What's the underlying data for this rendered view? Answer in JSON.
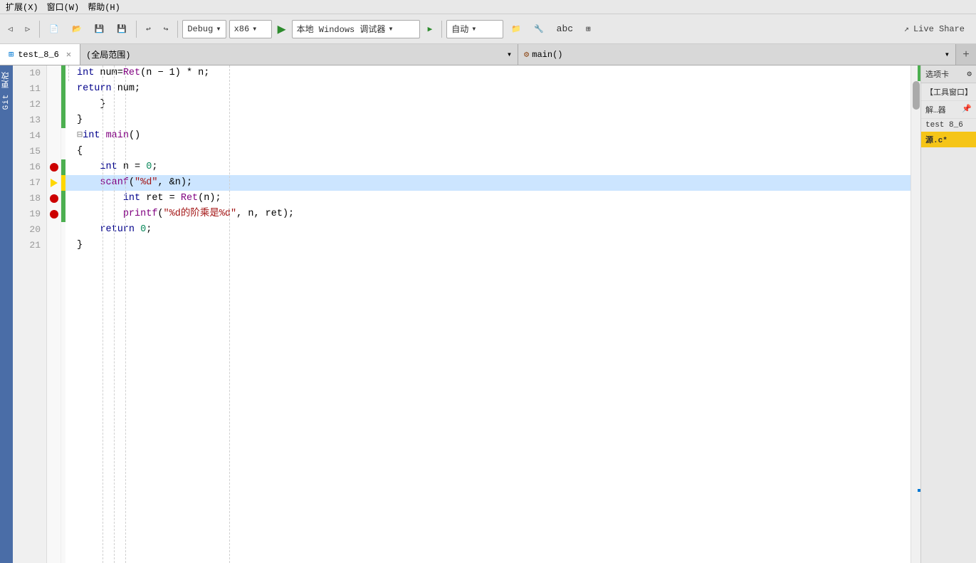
{
  "menubar": {
    "items": [
      "扩展(X)",
      "窗口(W)",
      "帮助(H)"
    ]
  },
  "toolbar": {
    "back_btn": "◀",
    "forward_btn": "▶",
    "debug_label": "Debug",
    "platform_label": "x86",
    "run_icon": "▶",
    "local_debug_label": "本地 Windows 调试器",
    "run2_icon": "▶",
    "auto_label": "自动",
    "live_share_label": "Live Share"
  },
  "tabs": {
    "file_tab": "test_8_6",
    "scope_placeholder": "(全局范围)",
    "func_placeholder": "main()",
    "add_btn": "+"
  },
  "sidebar": {
    "git_label": "Git 更改"
  },
  "code": {
    "lines": [
      {
        "num": "10",
        "content": "    int num=Ret(n − 1) * n;",
        "type": "normal",
        "has_breakpoint": false,
        "has_change": true
      },
      {
        "num": "11",
        "content": "    return num;",
        "type": "normal",
        "has_breakpoint": false,
        "has_change": true
      },
      {
        "num": "12",
        "content": "    }",
        "type": "normal",
        "has_breakpoint": false,
        "has_change": true
      },
      {
        "num": "13",
        "content": "}",
        "type": "normal",
        "has_breakpoint": false,
        "has_change": true
      },
      {
        "num": "14",
        "content": "⊟int main()",
        "type": "normal",
        "has_breakpoint": false,
        "has_change": false
      },
      {
        "num": "15",
        "content": "{",
        "type": "normal",
        "has_breakpoint": false,
        "has_change": false
      },
      {
        "num": "16",
        "content": "    int n = 0;",
        "type": "normal",
        "has_breakpoint": true,
        "has_change": true
      },
      {
        "num": "17",
        "content": "    scanf(\"%d\", &n);",
        "type": "highlighted",
        "has_breakpoint": false,
        "has_change": false,
        "has_arrow": true
      },
      {
        "num": "18",
        "content": "        int ret = Ret(n);",
        "type": "normal",
        "has_breakpoint": true,
        "has_change": true
      },
      {
        "num": "19",
        "content": "        printf(\"%d的阶乘是%d\", n, ret);",
        "type": "normal",
        "has_breakpoint": true,
        "has_change": true
      },
      {
        "num": "20",
        "content": "    return 0;",
        "type": "normal",
        "has_breakpoint": false,
        "has_change": false
      },
      {
        "num": "21",
        "content": "}",
        "type": "normal",
        "has_breakpoint": false,
        "has_change": false
      }
    ]
  },
  "right_panel": {
    "header_label": "选项卡",
    "gear_icon": "⚙",
    "section1": "【工具窗口】",
    "section2": "解…器",
    "pin_icon": "📌",
    "file1": "test 8_6",
    "file2": "源.c*"
  }
}
